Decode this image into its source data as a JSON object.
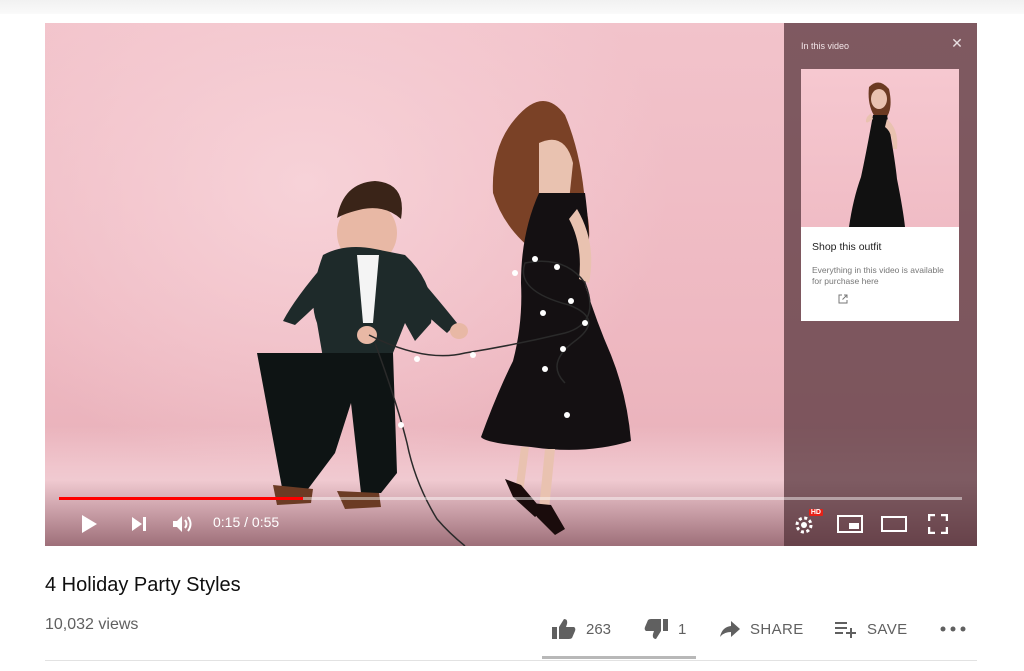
{
  "player": {
    "progress": 0.27,
    "time_current": "0:15",
    "time_separator": " / ",
    "time_total": "0:55",
    "hd_badge": "HD",
    "icons": [
      "play-icon",
      "next-icon",
      "volume-icon",
      "settings-icon",
      "miniplayer-icon",
      "theater-icon",
      "fullscreen-icon"
    ]
  },
  "shopping_panel": {
    "title": "In this video",
    "product_name": "Shop this outfit",
    "product_description": "Everything in this video is available for purchase here"
  },
  "video": {
    "title": "4 Holiday Party Styles",
    "views": "10,032 views"
  },
  "actions": {
    "likes": "263",
    "dislikes": "1",
    "share_label": "SHARE",
    "save_label": "SAVE"
  },
  "colors": {
    "progress_red": "#ff0000",
    "background_pink": "#f0bfc8",
    "panel_overlay": "#523037"
  }
}
